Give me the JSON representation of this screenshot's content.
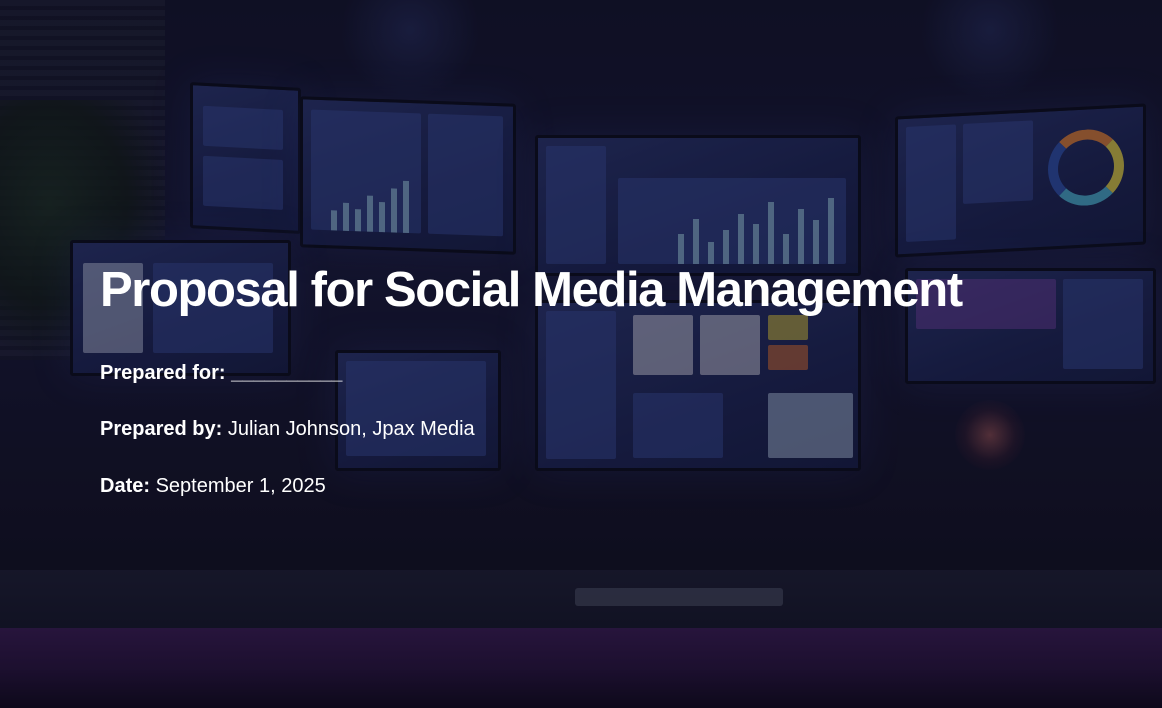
{
  "title": "Proposal for Social Media Management",
  "prepared_for": {
    "label": "Prepared for:",
    "value": "__________"
  },
  "prepared_by": {
    "label": "Prepared by:",
    "value": "Julian Johnson, Jpax Media"
  },
  "date": {
    "label": "Date:",
    "value": "September 1, 2025"
  },
  "colors": {
    "text": "#ffffff",
    "background": "#14152e",
    "accent_glow": "#3b1d55"
  }
}
